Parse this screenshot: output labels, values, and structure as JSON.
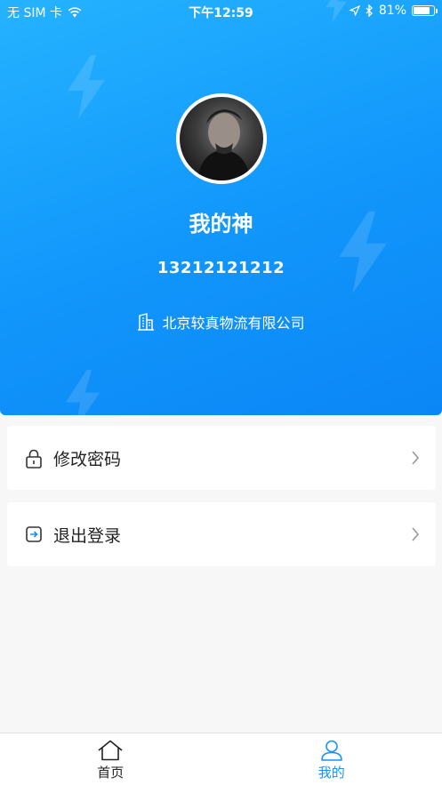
{
  "status_bar": {
    "carrier": "无 SIM 卡",
    "time": "下午12:59",
    "battery_percent": "81%",
    "battery_level": 0.81
  },
  "profile": {
    "name": "我的神",
    "phone": "13212121212",
    "company": "北京较真物流有限公司"
  },
  "menu": {
    "items": [
      {
        "label": "修改密码",
        "icon": "lock-icon"
      },
      {
        "label": "退出登录",
        "icon": "logout-icon"
      }
    ]
  },
  "tab_bar": {
    "tabs": [
      {
        "label": "首页",
        "icon": "home-icon",
        "active": false
      },
      {
        "label": "我的",
        "icon": "user-icon",
        "active": true
      }
    ]
  },
  "colors": {
    "primary": "#1a93f6",
    "header_start": "#25b3ff",
    "header_end": "#0b86f6",
    "background": "#f7f7f7"
  }
}
